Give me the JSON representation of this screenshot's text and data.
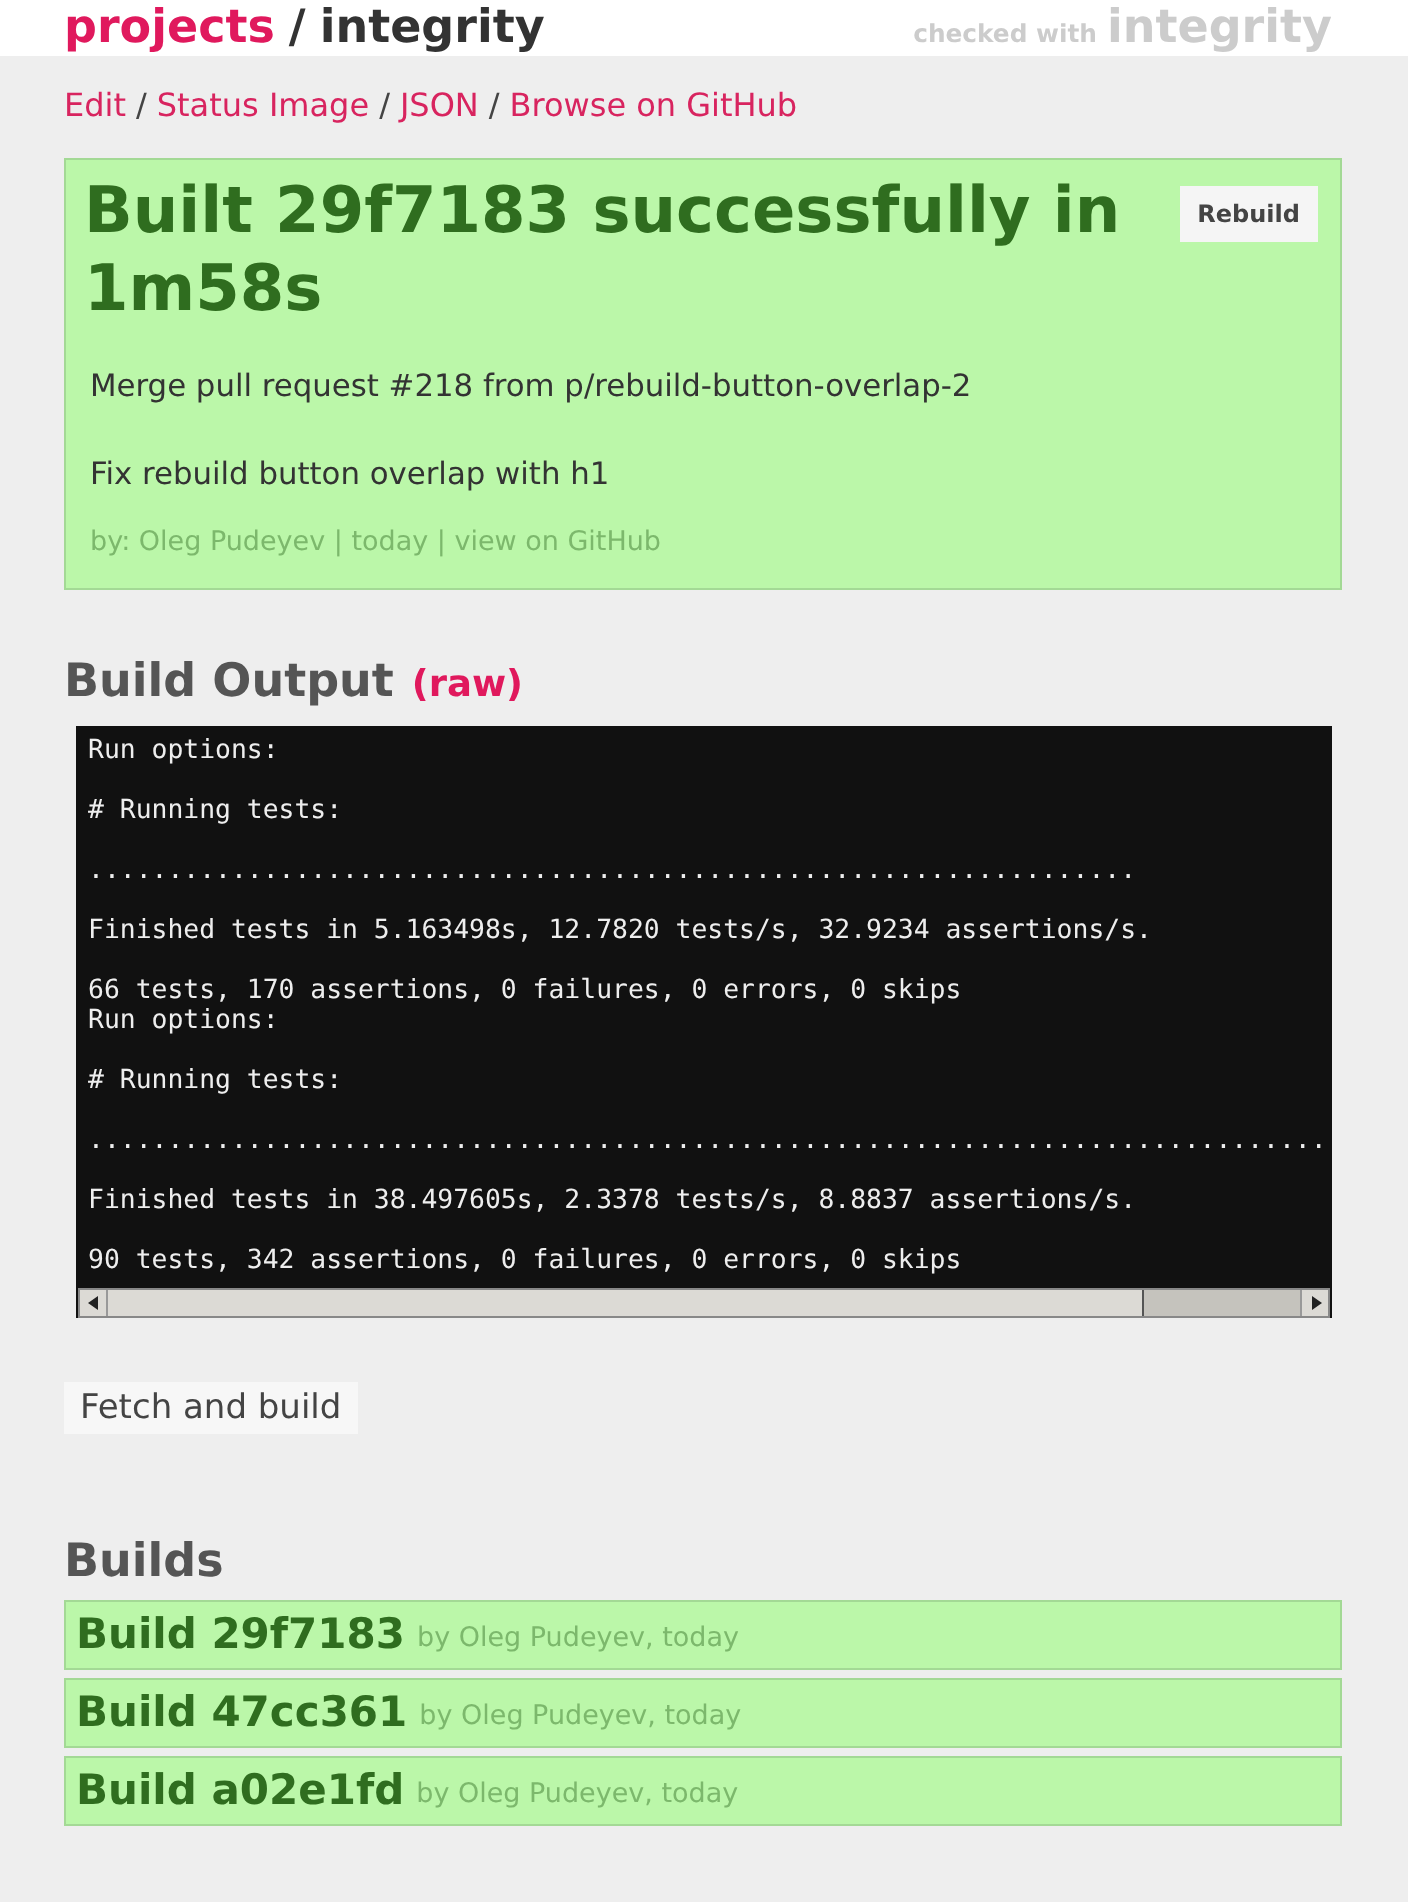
{
  "header": {
    "breadcrumb": {
      "root": "projects",
      "separator": "/",
      "current": "integrity"
    },
    "credit": {
      "prefix": "checked with",
      "brand": "integrity"
    }
  },
  "nav": {
    "separator": "/",
    "links": [
      "Edit",
      "Status Image",
      "JSON",
      "Browse on GitHub"
    ]
  },
  "build_status": {
    "passed": true,
    "title": "Built 29f7183 successfully in 1m58s",
    "button": "Rebuild",
    "commit_message": [
      "Merge pull request #218 from p/rebuild-button-overlap-2",
      "Fix rebuild button overlap with h1"
    ],
    "meta": "by: Oleg Pudeyev | today |",
    "meta_link": "view on GitHub"
  },
  "output": {
    "heading": "Build Output",
    "raw_link": "(raw)",
    "log": "Run options:\n\n# Running tests:\n\n..................................................................\n\nFinished tests in 5.163498s, 12.7820 tests/s, 32.9234 assertions/s.\n\n66 tests, 170 assertions, 0 failures, 0 errors, 0 skips\nRun options:\n\n# Running tests:\n\n..............................................................................\n\nFinished tests in 38.497605s, 2.3378 tests/s, 8.8837 assertions/s.\n\n90 tests, 342 assertions, 0 failures, 0 errors, 0 skips"
  },
  "fetch_button": "Fetch and build",
  "builds": {
    "heading": "Builds",
    "items": [
      {
        "passed": true,
        "title": "Build 29f7183",
        "meta": "by Oleg Pudeyev, today"
      },
      {
        "passed": true,
        "title": "Build 47cc361",
        "meta": "by Oleg Pudeyev, today"
      },
      {
        "passed": true,
        "title": "Build a02e1fd",
        "meta": "by Oleg Pudeyev, today"
      }
    ]
  }
}
